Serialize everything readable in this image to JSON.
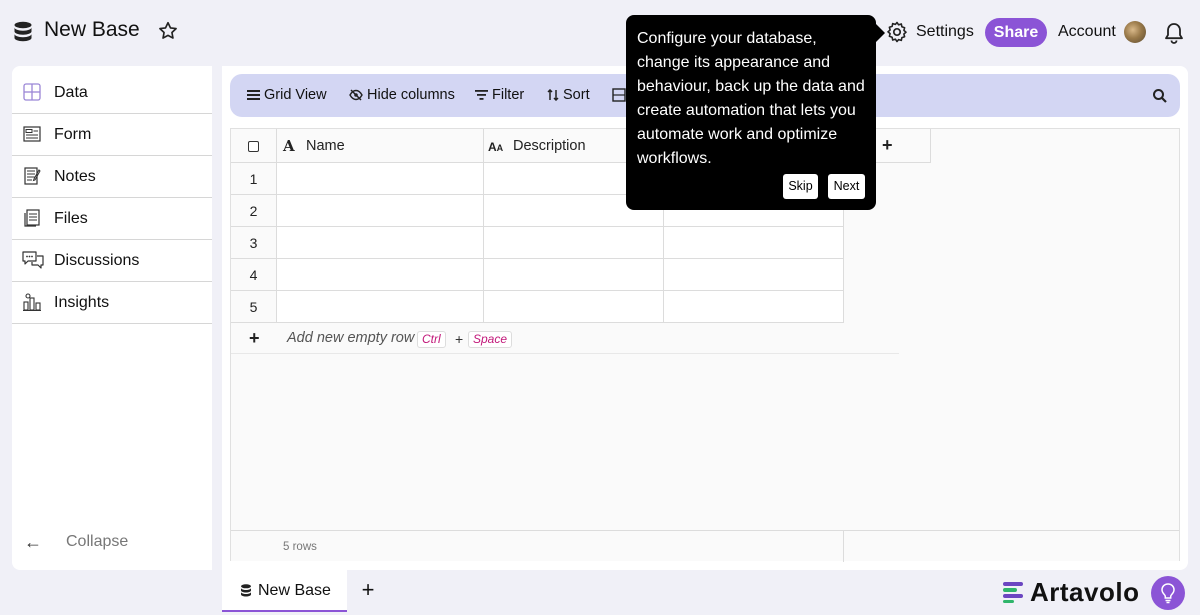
{
  "header": {
    "title": "New Base",
    "settings_label": "Settings",
    "share_label": "Share",
    "account_label": "Account"
  },
  "sidebar": {
    "items": [
      {
        "label": "Data",
        "icon": "grid-icon"
      },
      {
        "label": "Form",
        "icon": "form-icon"
      },
      {
        "label": "Notes",
        "icon": "notes-icon"
      },
      {
        "label": "Files",
        "icon": "files-icon"
      },
      {
        "label": "Discussions",
        "icon": "discussions-icon"
      },
      {
        "label": "Insights",
        "icon": "insights-icon"
      }
    ],
    "collapse_label": "Collapse"
  },
  "toolbar": {
    "grid_view": "Grid View",
    "hide_columns": "Hide columns",
    "filter": "Filter",
    "sort": "Sort"
  },
  "table": {
    "columns": [
      "Name",
      "Description"
    ],
    "row_numbers": [
      "1",
      "2",
      "3",
      "4",
      "5"
    ],
    "add_row_label": "Add new empty row",
    "shortcut_key1": "Ctrl",
    "shortcut_plus": "+",
    "shortcut_key2": "Space",
    "row_count": "5 rows"
  },
  "tooltip": {
    "text": "Configure your database, change its appearance and behaviour, back up the data and create automation that lets you automate work and optimize workflows.",
    "skip_label": "Skip",
    "next_label": "Next"
  },
  "bottom": {
    "tab_label": "New Base",
    "brand_name": "Artavolo"
  },
  "colors": {
    "accent": "#8b54d6",
    "toolbar_bg": "#d3d6f3",
    "page_bg": "#f0f0f7"
  }
}
